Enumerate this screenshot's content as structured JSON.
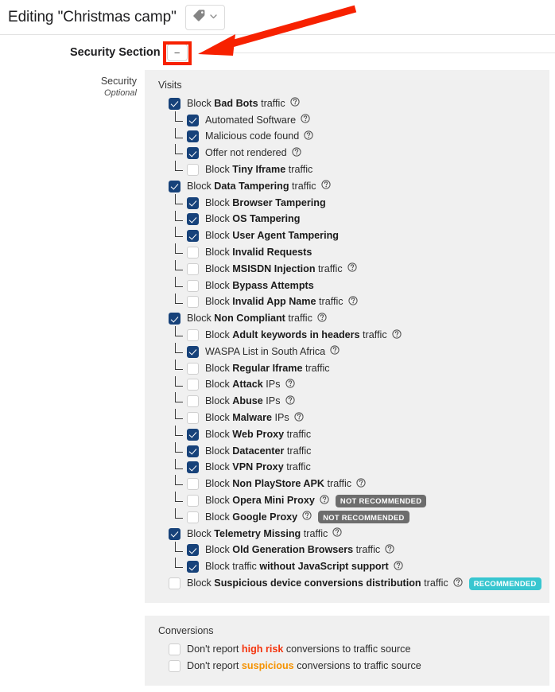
{
  "header": {
    "title": "Editing \"Christmas camp\"",
    "tag_button": {
      "icon": "tag-icon",
      "chevron": "chevron-down-icon"
    }
  },
  "section": {
    "title": "Security Section",
    "collapse_label": "−"
  },
  "field": {
    "label": "Security",
    "sublabel": "Optional"
  },
  "colors": {
    "checkbox_on": "#17427a",
    "badge_not_recommended": "#6d6d6d",
    "badge_recommended": "#38c6d0",
    "annotation": "#f72100",
    "panel_bg": "#f0f0f0",
    "high_risk": "#f4340d",
    "suspicious": "#f59200"
  },
  "visits": {
    "title": "Visits",
    "rows": [
      {
        "level": 0,
        "checked": true,
        "pre": "Block ",
        "strong": "Bad Bots",
        "post": " traffic",
        "help": true
      },
      {
        "level": 1,
        "checked": true,
        "pre": "Automated Software",
        "strong": "",
        "post": "",
        "help": true
      },
      {
        "level": 1,
        "checked": true,
        "pre": "Malicious code found",
        "strong": "",
        "post": "",
        "help": true
      },
      {
        "level": 1,
        "checked": true,
        "pre": "Offer not rendered",
        "strong": "",
        "post": "",
        "help": true
      },
      {
        "level": 1,
        "checked": false,
        "pre": "Block ",
        "strong": "Tiny Iframe",
        "post": " traffic",
        "help": false
      },
      {
        "level": 0,
        "checked": true,
        "pre": "Block ",
        "strong": "Data Tampering",
        "post": " traffic",
        "help": true
      },
      {
        "level": 1,
        "checked": true,
        "pre": "Block ",
        "strong": "Browser Tampering",
        "post": "",
        "help": false
      },
      {
        "level": 1,
        "checked": true,
        "pre": "Block ",
        "strong": "OS Tampering",
        "post": "",
        "help": false
      },
      {
        "level": 1,
        "checked": true,
        "pre": "Block ",
        "strong": "User Agent Tampering",
        "post": "",
        "help": false
      },
      {
        "level": 1,
        "checked": false,
        "pre": "Block ",
        "strong": "Invalid Requests",
        "post": "",
        "help": false
      },
      {
        "level": 1,
        "checked": false,
        "pre": "Block ",
        "strong": "MSISDN Injection",
        "post": " traffic",
        "help": true
      },
      {
        "level": 1,
        "checked": false,
        "pre": "Block ",
        "strong": "Bypass Attempts",
        "post": "",
        "help": false
      },
      {
        "level": 1,
        "checked": false,
        "pre": "Block ",
        "strong": "Invalid App Name",
        "post": " traffic",
        "help": true
      },
      {
        "level": 0,
        "checked": true,
        "pre": "Block ",
        "strong": "Non Compliant",
        "post": " traffic",
        "help": true
      },
      {
        "level": 1,
        "checked": false,
        "pre": "Block ",
        "strong": "Adult keywords in headers",
        "post": " traffic",
        "help": true
      },
      {
        "level": 1,
        "checked": true,
        "pre": "WASPA List in South Africa",
        "strong": "",
        "post": "",
        "help": true
      },
      {
        "level": 1,
        "checked": false,
        "pre": "Block ",
        "strong": "Regular Iframe",
        "post": " traffic",
        "help": false
      },
      {
        "level": 1,
        "checked": false,
        "pre": "Block ",
        "strong": "Attack",
        "post": " IPs",
        "help": true
      },
      {
        "level": 1,
        "checked": false,
        "pre": "Block ",
        "strong": "Abuse",
        "post": " IPs",
        "help": true
      },
      {
        "level": 1,
        "checked": false,
        "pre": "Block ",
        "strong": "Malware",
        "post": " IPs",
        "help": true
      },
      {
        "level": 1,
        "checked": true,
        "pre": "Block ",
        "strong": "Web Proxy",
        "post": " traffic",
        "help": false
      },
      {
        "level": 1,
        "checked": true,
        "pre": "Block ",
        "strong": "Datacenter",
        "post": " traffic",
        "help": false
      },
      {
        "level": 1,
        "checked": true,
        "pre": "Block ",
        "strong": "VPN Proxy",
        "post": " traffic",
        "help": false
      },
      {
        "level": 1,
        "checked": false,
        "pre": "Block ",
        "strong": "Non PlayStore APK",
        "post": " traffic",
        "help": true
      },
      {
        "level": 1,
        "checked": false,
        "pre": "Block ",
        "strong": "Opera Mini Proxy",
        "post": "",
        "help": true,
        "badge": "NOT RECOMMENDED",
        "badge_type": "not-rec"
      },
      {
        "level": 1,
        "checked": false,
        "pre": "Block ",
        "strong": "Google Proxy",
        "post": "",
        "help": true,
        "badge": "NOT RECOMMENDED",
        "badge_type": "not-rec"
      },
      {
        "level": 0,
        "checked": true,
        "pre": "Block ",
        "strong": "Telemetry Missing",
        "post": " traffic",
        "help": true
      },
      {
        "level": 1,
        "checked": true,
        "pre": "Block ",
        "strong": "Old Generation Browsers",
        "post": " traffic",
        "help": true
      },
      {
        "level": 1,
        "checked": true,
        "pre": "Block traffic ",
        "strong": "without JavaScript support",
        "post": "",
        "help": true
      },
      {
        "level": 0,
        "checked": false,
        "pre": "Block ",
        "strong": "Suspicious device conversions distribution",
        "post": " traffic",
        "help": true,
        "badge": "RECOMMENDED",
        "badge_type": "rec"
      }
    ]
  },
  "conversions": {
    "title": "Conversions",
    "rows": [
      {
        "checked": false,
        "pre": "Don't report ",
        "hl": "high risk",
        "hl_class": "hl-red",
        "post": " conversions to traffic source"
      },
      {
        "checked": false,
        "pre": "Don't report ",
        "hl": "suspicious",
        "hl_class": "hl-orange",
        "post": " conversions to traffic source"
      }
    ]
  }
}
